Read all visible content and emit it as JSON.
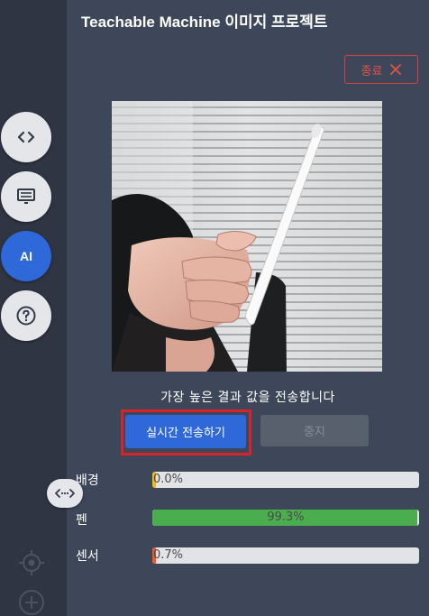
{
  "header": {
    "title": "Teachable Machine 이미지 프로젝트"
  },
  "toolbar": {
    "close_label": "종료",
    "send_label": "실시간 전송하기",
    "stop_label": "중지"
  },
  "left_rail": {
    "items": [
      {
        "icon": "code-icon"
      },
      {
        "icon": "monitor-icon"
      },
      {
        "icon": "ai-icon",
        "label": "AI"
      },
      {
        "icon": "help-icon"
      }
    ]
  },
  "result": {
    "caption": "가장 높은 결과 값을 전송합니다",
    "classes": [
      {
        "name": "배경",
        "percent_text": "0.0%",
        "value": 0.0,
        "color": "#f3b915"
      },
      {
        "name": "펜",
        "percent_text": "99.3%",
        "value": 99.3,
        "color": "#4aae4f"
      },
      {
        "name": "센서",
        "percent_text": "0.7%",
        "value": 0.7,
        "color": "#ef5a26"
      }
    ]
  },
  "colors": {
    "accent": "#2f68d8",
    "close": "#e0534a",
    "panel": "#3e4759",
    "rail": "#2f3543"
  }
}
